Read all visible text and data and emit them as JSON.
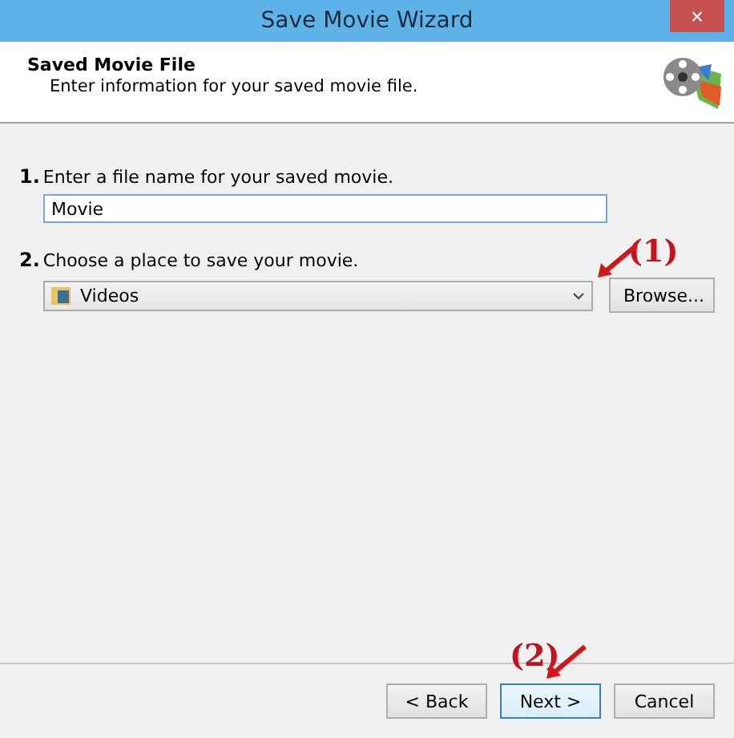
{
  "window": {
    "title": "Save Movie Wizard",
    "close": "×"
  },
  "header": {
    "title": "Saved Movie File",
    "subtitle": "Enter information for your saved movie file."
  },
  "steps": [
    {
      "number": "1.",
      "label": "Enter a file name for your saved movie.",
      "kind": "text",
      "value": "Movie"
    },
    {
      "number": "2.",
      "label": "Choose a place to save your movie.",
      "kind": "dropdown",
      "value": "Videos",
      "button": "Browse..."
    }
  ],
  "buttons": [
    {
      "label": "< Back",
      "default": false
    },
    {
      "label": "Next >",
      "default": true
    },
    {
      "label": "Cancel",
      "default": false
    }
  ],
  "annotations": [
    {
      "label": "(1)"
    },
    {
      "label": "(2)"
    }
  ]
}
